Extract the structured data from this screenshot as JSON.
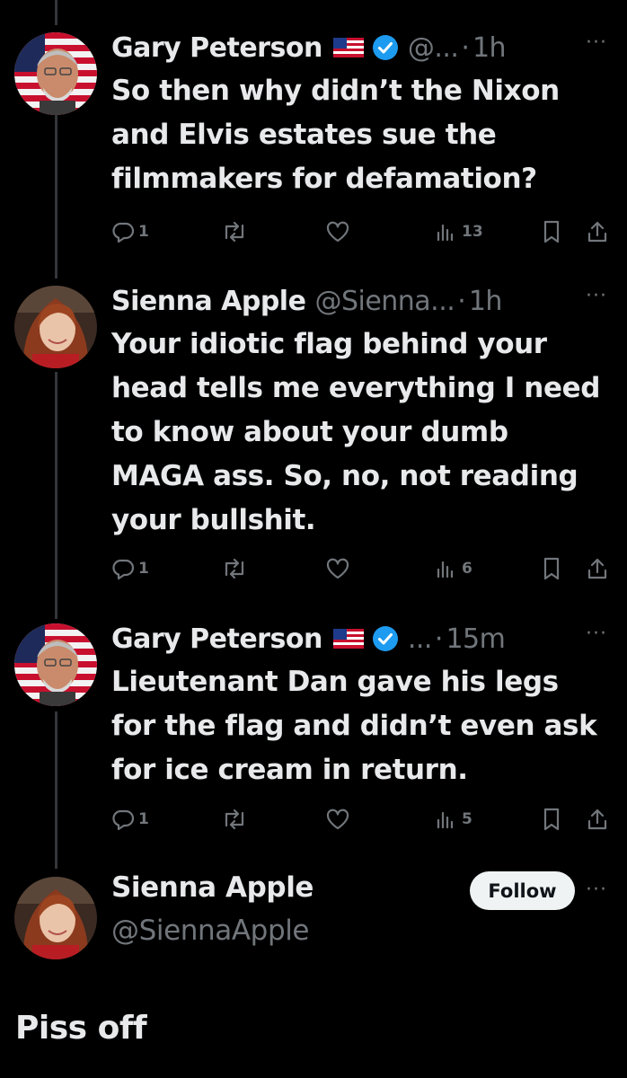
{
  "tweets": [
    {
      "name": "Gary Peterson",
      "flag_icon": "us-flag-icon",
      "verified": true,
      "handle": "@...",
      "separator": "·",
      "time": "1h",
      "more": "···",
      "text": "So then why didn’t the Nixon and Elvis estates sue the filmmakers for defamation?",
      "replies": "1",
      "retweets": "",
      "likes": "",
      "views": "13"
    },
    {
      "name": "Sienna Apple",
      "verified": false,
      "handle": "@Sienna...",
      "separator": "·",
      "time": "1h",
      "more": "···",
      "text": "Your idiotic flag behind your head tells me everything I need to know about your dumb MAGA ass. So, no, not reading your bullshit.",
      "replies": "1",
      "retweets": "",
      "likes": "",
      "views": "6"
    },
    {
      "name": "Gary Peterson",
      "flag_icon": "us-flag-icon",
      "verified": true,
      "handle": "...",
      "separator": "·",
      "time": "15m",
      "more": "···",
      "text": "Lieutenant Dan gave his legs for the flag and didn’t even ask for ice cream in return.",
      "replies": "1",
      "retweets": "",
      "likes": "",
      "views": "5"
    }
  ],
  "main_post": {
    "name": "Sienna Apple",
    "handle": "@SiennaApple",
    "follow_label": "Follow",
    "more": "···",
    "text": "Piss off"
  },
  "colors": {
    "background": "#000000",
    "text": "#e7e9ea",
    "muted": "#71767b",
    "verified_blue": "#1d9bf0",
    "follow_bg": "#eff3f4"
  }
}
